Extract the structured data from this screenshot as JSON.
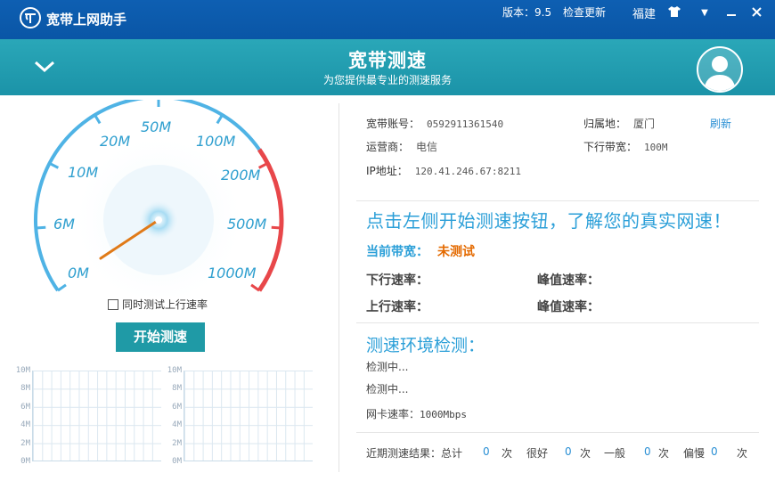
{
  "app": {
    "title": "宽带上网助手",
    "version": "版本：9.5",
    "check_update": "检查更新",
    "location": "福建"
  },
  "banner": {
    "title": "宽带测速",
    "subtitle": "为您提供最专业的测速服务"
  },
  "gauge": {
    "labels": [
      "0M",
      "6M",
      "10M",
      "20M",
      "50M",
      "100M",
      "200M",
      "500M",
      "1000M"
    ],
    "needle_value": "0M"
  },
  "controls": {
    "test_upload_label": "同时测试上行速率",
    "start_button": "开始测速"
  },
  "mini_charts": {
    "y_ticks": [
      "10M",
      "8M",
      "6M",
      "4M",
      "2M",
      "0M"
    ]
  },
  "info": {
    "account_label": "宽带账号：",
    "account_value": "0592911361540",
    "region_label": "归属地：",
    "region_value": "厦门",
    "refresh": "刷新",
    "isp_label": "运营商：",
    "isp_value": "电信",
    "down_bw_label": "下行带宽：",
    "down_bw_value": "100M",
    "ip_label": "IP地址：",
    "ip_value": "120.41.246.67:8211"
  },
  "speed": {
    "prompt": "点击左侧开始测速按钮，了解您的真实网速！",
    "current_label": "当前带宽：",
    "current_value": "未测试",
    "down_rate_label": "下行速率：",
    "peak1_label": "峰值速率：",
    "up_rate_label": "上行速率：",
    "peak2_label": "峰值速率："
  },
  "environment": {
    "title": "测速环境检测：",
    "line1": "检测中...",
    "line2": "检测中...",
    "nic_label": "网卡速率：",
    "nic_value": "1000Mbps"
  },
  "recent": {
    "label": "近期测速结果：总计",
    "total": "0",
    "times": "次",
    "good_label": "很好",
    "good": "0",
    "normal_label": "一般",
    "normal": "0",
    "slow_label": "偏慢",
    "slow": "0"
  },
  "colors": {
    "titlebar": "#0e5fb2",
    "banner": "#24a0b3",
    "accent": "#2b9fd8",
    "button": "#1f9aa6",
    "highlight": "#e46a00",
    "gauge_red": "#e8474a"
  }
}
